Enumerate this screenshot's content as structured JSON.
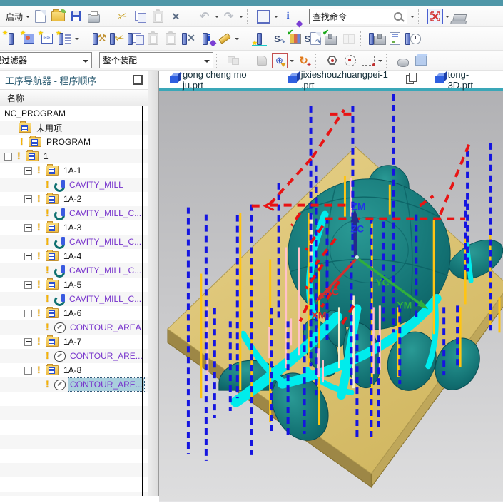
{
  "window": {
    "accent_color": "#4f97a8",
    "toolpath_cyan": "#00ecec",
    "rapid_red": "#e81414",
    "level_blue": "#1515e0",
    "engage_gold": "#ffc413",
    "plate_tan": "#dcc377",
    "model_teal": "#0f6b6e"
  },
  "toolbar1": {
    "start_label": "启动",
    "find_placeholder": "查找命令",
    "icons": [
      "new-file",
      "open-file",
      "save",
      "print",
      "cut",
      "copy",
      "paste",
      "delete",
      "undo",
      "redo",
      "display-style",
      "information",
      "find-command",
      "fullscreen",
      "window-display"
    ]
  },
  "toolbar2": {
    "icons": [
      "create-tool",
      "create-geometry",
      "create-method",
      "create-operation",
      "edit-object",
      "cut-object",
      "copy-object",
      "paste-object",
      "paste-special",
      "delete-object",
      "object-information",
      "flashlight",
      "generate-toolpath",
      "replay-toolpath",
      "verify-toolpath",
      "postprocess",
      "simulate-machine",
      "compare-documents",
      "machine-tool-view",
      "shop-documentation",
      "toolpath-time"
    ]
  },
  "toolbar3": {
    "type_filter_value": "类型过滤器",
    "assembly_scope_value": "整个装配",
    "icons": [
      "assembly-constraints",
      "hand-tool",
      "snap-point-filter",
      "rotate-reference-point",
      "hexagon-select",
      "circle-select",
      "rectangle-select",
      "mouse-mode",
      "shaded-display"
    ]
  },
  "navigator": {
    "title": "工序导航器 - 程序顺序",
    "column_header": "名称",
    "tree": [
      {
        "label": "NC_PROGRAM"
      },
      {
        "label": "未用项"
      },
      {
        "label": "PROGRAM"
      },
      {
        "label": "1"
      },
      {
        "label": "1A-1"
      },
      {
        "label": "CAVITY_MILL"
      },
      {
        "label": "1A-2"
      },
      {
        "label": "CAVITY_MILL_C..."
      },
      {
        "label": "1A-3"
      },
      {
        "label": "CAVITY_MILL_C..."
      },
      {
        "label": "1A-4"
      },
      {
        "label": "CAVITY_MILL_C..."
      },
      {
        "label": "1A-5"
      },
      {
        "label": "CAVITY_MILL_C..."
      },
      {
        "label": "1A-6"
      },
      {
        "label": "CONTOUR_AREA"
      },
      {
        "label": "1A-7"
      },
      {
        "label": "CONTOUR_ARE..."
      },
      {
        "label": "1A-8"
      },
      {
        "label": "CONTOUR_ARE...",
        "selected": true
      }
    ]
  },
  "tabs": [
    {
      "label": "gong cheng mo ju.prt"
    },
    {
      "label": "jixieshouzhuangpei-1 .prt"
    },
    {
      "label": "tong-3D.prt"
    }
  ],
  "viewport": {
    "axis_labels": {
      "zm": "ZM",
      "zc": "ZC",
      "xc": "XC",
      "xm": "XM",
      "yc": "YC",
      "ym": "YM"
    }
  }
}
